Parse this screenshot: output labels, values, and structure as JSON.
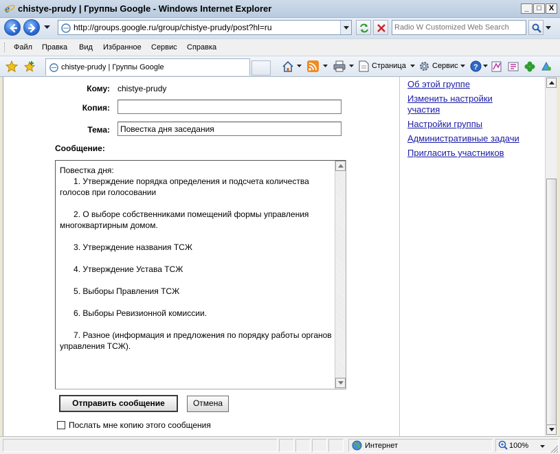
{
  "window": {
    "title": "chistye-prudy | Группы Google - Windows Internet Explorer",
    "minimize": "_",
    "maximize": "□",
    "close": "X"
  },
  "address": {
    "url": "http://groups.google.ru/group/chistye-prudy/post?hl=ru"
  },
  "search": {
    "placeholder": "Radio W Customized Web Search"
  },
  "menu": {
    "items": [
      "Файл",
      "Правка",
      "Вид",
      "Избранное",
      "Сервис",
      "Справка"
    ]
  },
  "tab": {
    "title": "chistye-prudy | Группы Google"
  },
  "toolbar": {
    "page_label": "Страница",
    "tools_label": "Сервис"
  },
  "form": {
    "to_label": "Кому:",
    "to_value": "chistye-prudy",
    "cc_label": "Копия:",
    "cc_value": "",
    "subject_label": "Тема:",
    "subject_value": "Повестка дня заседания",
    "message_label": "Сообщение:",
    "message_text": "Повестка дня:\n      1. Утверждение порядка определения и подсчета количества голосов при голосовании\n\n      2. О выборе собственниками помещений формы управления многоквартирным домом.\n\n      3. Утверждение названия ТСЖ\n\n      4. Утверждение Устава ТСЖ\n\n      5. Выборы Правления ТСЖ\n\n      6. Выборы Ревизионной комиссии.\n\n      7. Разное (информация и предложения по порядку работы органов управления ТСЖ).",
    "send_button": "Отправить сообщение",
    "cancel_button": "Отмена",
    "copy_checkbox_label": "Послать мне копию этого сообщения",
    "copy_checked": false
  },
  "sidebar": {
    "links": [
      "Об этой группе",
      "Изменить настройки участия",
      "Настройки группы",
      "Административные задачи",
      "Пригласить участников"
    ]
  },
  "status": {
    "zone": "Интернет",
    "zoom": "100%"
  },
  "colors": {
    "link": "#1a1aa6",
    "titlebar": "#c4d3e6"
  }
}
